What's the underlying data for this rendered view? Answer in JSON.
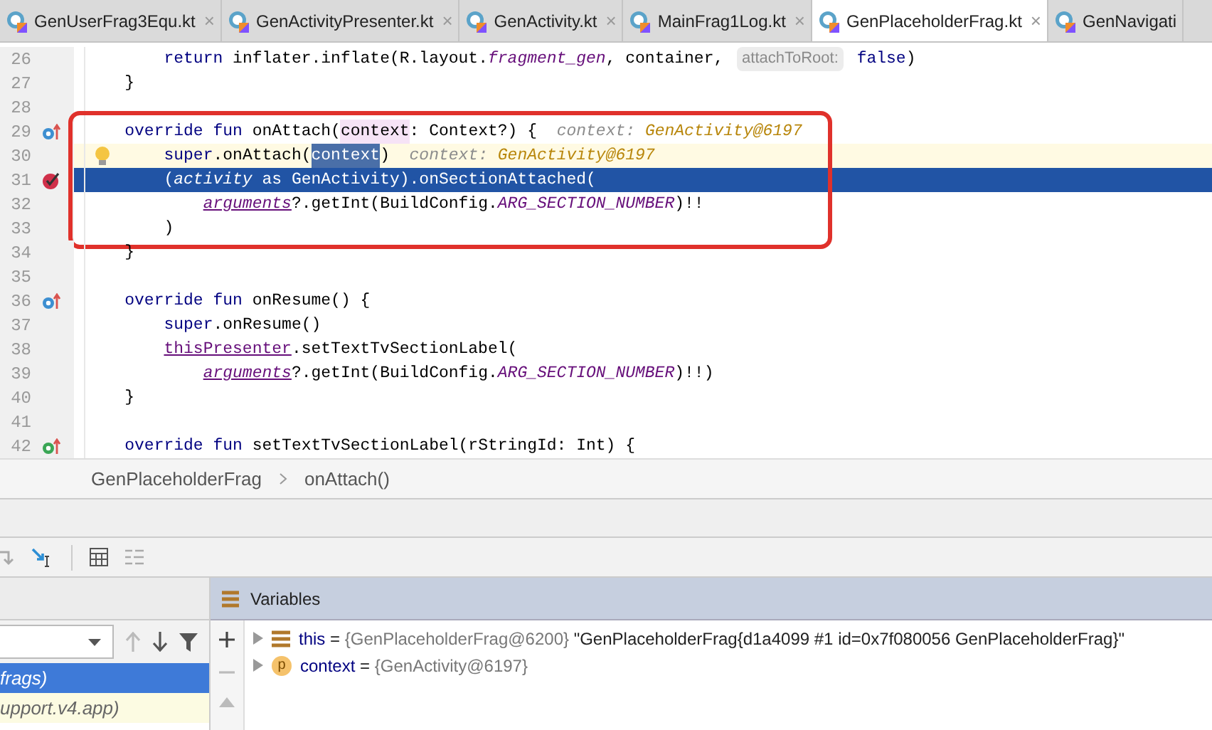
{
  "tabs": [
    {
      "label": "GenUserFrag3Equ.kt",
      "close": "×",
      "selected": false
    },
    {
      "label": "GenActivityPresenter.kt",
      "close": "×",
      "selected": false
    },
    {
      "label": "GenActivity.kt",
      "close": "×",
      "selected": false
    },
    {
      "label": "MainFrag1Log.kt",
      "close": "×",
      "selected": false
    },
    {
      "label": "GenPlaceholderFrag.kt",
      "close": "×",
      "selected": true
    },
    {
      "label": "GenNavigati",
      "selected": false
    }
  ],
  "editor": {
    "lines": [
      {
        "number": "26",
        "kind": "plain",
        "tokens": [
          {
            "kind": "kw",
            "t": "        return"
          },
          {
            "kind": "plain",
            "t": " inflater.inflate(R.layout."
          },
          {
            "kind": "field",
            "t": "fragment_gen"
          },
          {
            "kind": "plain",
            "t": ", container, "
          },
          {
            "kind": "hint",
            "t": "attachToRoot:"
          },
          {
            "kind": "kw",
            "t": " false"
          },
          {
            "kind": "plain",
            "t": ")"
          }
        ]
      },
      {
        "number": "27",
        "kind": "plain",
        "tokens": [
          {
            "kind": "plain",
            "t": "    }"
          }
        ]
      },
      {
        "number": "28",
        "kind": "plain"
      },
      {
        "number": "29",
        "kind": "override",
        "annotated": true,
        "tokens": [
          {
            "kind": "kw",
            "t": "    override fun"
          },
          {
            "kind": "plain",
            "t": " onAttach("
          },
          {
            "kind": "usage",
            "t": "context"
          },
          {
            "kind": "plain",
            "t": ": Context?) {"
          },
          {
            "kind": "debug-name",
            "t": "  context: "
          },
          {
            "kind": "debug-value",
            "t": "GenActivity@6197"
          }
        ]
      },
      {
        "number": "30",
        "kind": "plain",
        "caret_line": true,
        "annotated": true,
        "tokens": [
          {
            "kind": "kw",
            "t": "        super"
          },
          {
            "kind": "plain",
            "t": ".onAttach("
          },
          {
            "kind": "selection",
            "t": "context"
          },
          {
            "kind": "plain",
            "t": ")"
          },
          {
            "kind": "debug-name",
            "t": "  context: "
          },
          {
            "kind": "debug-value",
            "t": "GenActivity@6197"
          }
        ]
      },
      {
        "number": "31",
        "kind": "breakpoint",
        "execution_point": true,
        "annotated": true,
        "tokens": [
          {
            "kind": "plain",
            "t": "        ("
          },
          {
            "kind": "field",
            "t": "activity"
          },
          {
            "kind": "kw",
            "t": " as"
          },
          {
            "kind": "plain",
            "t": " GenActivity).onSectionAttached("
          }
        ]
      },
      {
        "number": "32",
        "kind": "plain",
        "annotated": true,
        "tokens": [
          {
            "kind": "ref",
            "t": "            arguments"
          },
          {
            "kind": "plain",
            "t": "?.getInt(BuildConfig."
          },
          {
            "kind": "field",
            "t": "ARG_SECTION_NUMBER"
          },
          {
            "kind": "plain",
            "t": ")!!"
          }
        ]
      },
      {
        "number": "33",
        "kind": "plain",
        "annotated": true,
        "tokens": [
          {
            "kind": "plain",
            "t": "        )"
          }
        ]
      },
      {
        "number": "34",
        "kind": "plain",
        "tokens": [
          {
            "kind": "plain",
            "t": "    }"
          }
        ]
      },
      {
        "number": "35",
        "kind": "plain"
      },
      {
        "number": "36",
        "kind": "override",
        "tokens": [
          {
            "kind": "kw",
            "t": "    override fun"
          },
          {
            "kind": "plain",
            "t": " onResume() {"
          }
        ]
      },
      {
        "number": "37",
        "kind": "plain",
        "tokens": [
          {
            "kind": "kw",
            "t": "        super"
          },
          {
            "kind": "plain",
            "t": ".onResume()"
          }
        ]
      },
      {
        "number": "38",
        "kind": "plain",
        "tokens": [
          {
            "kind": "prop",
            "t": "        thisPresenter"
          },
          {
            "kind": "plain",
            "t": ".setTextTvSectionLabel("
          }
        ]
      },
      {
        "number": "39",
        "kind": "plain",
        "tokens": [
          {
            "kind": "ref",
            "t": "            arguments"
          },
          {
            "kind": "plain",
            "t": "?.getInt(BuildConfig."
          },
          {
            "kind": "field",
            "t": "ARG_SECTION_NUMBER"
          },
          {
            "kind": "plain",
            "t": ")!!)"
          }
        ]
      },
      {
        "number": "40",
        "kind": "plain",
        "tokens": [
          {
            "kind": "plain",
            "t": "    }"
          }
        ]
      },
      {
        "number": "41",
        "kind": "plain"
      },
      {
        "number": "42",
        "kind": "implements",
        "tokens": [
          {
            "kind": "kw",
            "t": "    override fun"
          },
          {
            "kind": "plain",
            "t": " setTextTvSectionLabel(rStringId: Int) {"
          }
        ]
      }
    ]
  },
  "breadcrumb": [
    "GenPlaceholderFrag",
    "onAttach()"
  ],
  "frames": {
    "items": [
      {
        "label": "frags)",
        "selected": true
      },
      {
        "label": "upport.v4.app)",
        "selected": false
      }
    ]
  },
  "variables": {
    "title": "Variables",
    "rows": [
      {
        "kind": "object",
        "name": "this",
        "eq": " = ",
        "ref": "{GenPlaceholderFrag@6200}",
        "value": "\"GenPlaceholderFrag{d1a4099 #1 id=0x7f080056 GenPlaceholderFrag}\""
      },
      {
        "kind": "param",
        "badge": "p",
        "name": "context",
        "eq": " = ",
        "ref": "{GenActivity@6197}"
      }
    ]
  }
}
